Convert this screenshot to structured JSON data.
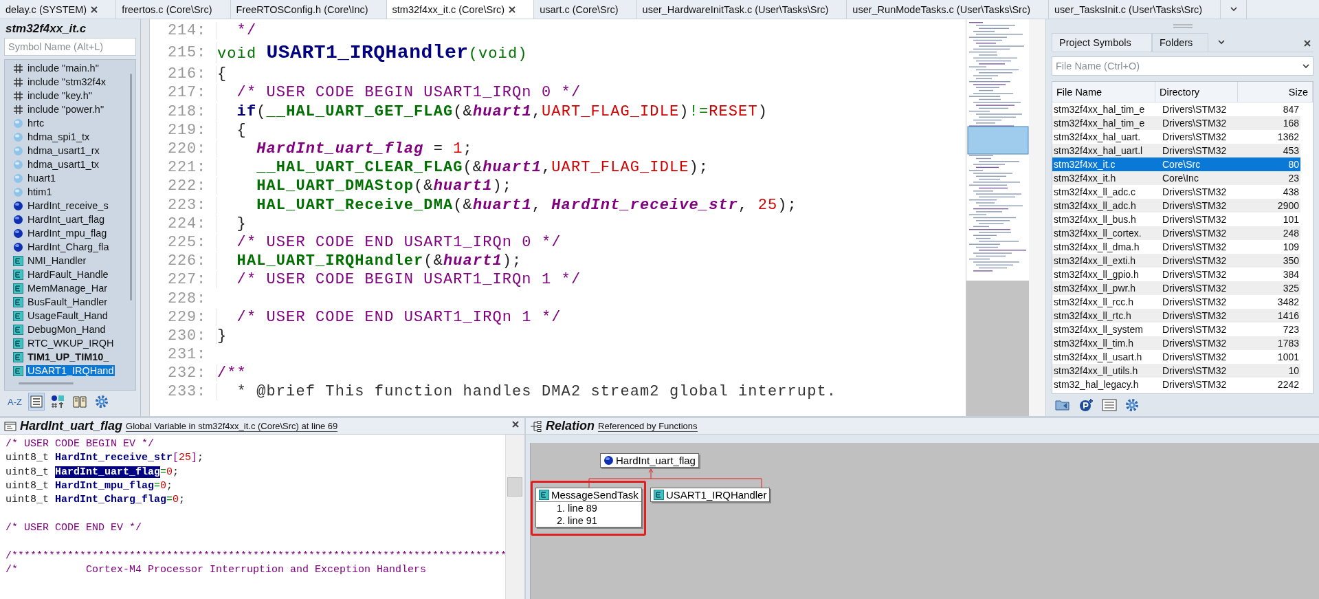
{
  "tabs": [
    {
      "label": "delay.c (SYSTEM)",
      "selected": false,
      "closable": true
    },
    {
      "label": "freertos.c (Core\\Src)",
      "selected": false,
      "closable": false
    },
    {
      "label": "FreeRTOSConfig.h (Core\\Inc)",
      "selected": false,
      "closable": false
    },
    {
      "label": "stm32f4xx_it.c (Core\\Src)",
      "selected": true,
      "closable": true
    },
    {
      "label": "usart.c (Core\\Src)",
      "selected": false,
      "closable": false
    },
    {
      "label": "user_HardwareInitTask.c (User\\Tasks\\Src)",
      "selected": false,
      "closable": false
    },
    {
      "label": "user_RunModeTasks.c (User\\Tasks\\Src)",
      "selected": false,
      "closable": false
    },
    {
      "label": "user_TasksInit.c (User\\Tasks\\Src)",
      "selected": false,
      "closable": false
    }
  ],
  "symbol_window": {
    "title": "stm32f4xx_it.c",
    "search_placeholder": "Symbol Name (Alt+L)",
    "sort_label": "A-Z",
    "items": [
      {
        "kind": "include",
        "label": "include \"main.h\"",
        "selected": false,
        "emphasized": false
      },
      {
        "kind": "include",
        "label": "include \"stm32f4x",
        "selected": false,
        "emphasized": false
      },
      {
        "kind": "include",
        "label": "include \"key.h\"",
        "selected": false,
        "emphasized": false
      },
      {
        "kind": "include",
        "label": "include \"power.h\"",
        "selected": false,
        "emphasized": false
      },
      {
        "kind": "extern",
        "label": "hrtc",
        "selected": false,
        "emphasized": false
      },
      {
        "kind": "extern",
        "label": "hdma_spi1_tx",
        "selected": false,
        "emphasized": false
      },
      {
        "kind": "extern",
        "label": "hdma_usart1_rx",
        "selected": false,
        "emphasized": false
      },
      {
        "kind": "extern",
        "label": "hdma_usart1_tx",
        "selected": false,
        "emphasized": false
      },
      {
        "kind": "extern",
        "label": "huart1",
        "selected": false,
        "emphasized": false
      },
      {
        "kind": "extern",
        "label": "htim1",
        "selected": false,
        "emphasized": false
      },
      {
        "kind": "variable",
        "label": "HardInt_receive_s",
        "selected": false,
        "emphasized": false
      },
      {
        "kind": "variable",
        "label": "HardInt_uart_flag",
        "selected": false,
        "emphasized": false
      },
      {
        "kind": "variable",
        "label": "HardInt_mpu_flag",
        "selected": false,
        "emphasized": false
      },
      {
        "kind": "variable",
        "label": "HardInt_Charg_fla",
        "selected": false,
        "emphasized": false
      },
      {
        "kind": "function",
        "label": "NMI_Handler",
        "selected": false,
        "emphasized": false
      },
      {
        "kind": "function",
        "label": "HardFault_Handle",
        "selected": false,
        "emphasized": false
      },
      {
        "kind": "function",
        "label": "MemManage_Har",
        "selected": false,
        "emphasized": false
      },
      {
        "kind": "function",
        "label": "BusFault_Handler",
        "selected": false,
        "emphasized": false
      },
      {
        "kind": "function",
        "label": "UsageFault_Hand",
        "selected": false,
        "emphasized": false
      },
      {
        "kind": "function",
        "label": "DebugMon_Hand",
        "selected": false,
        "emphasized": false
      },
      {
        "kind": "function",
        "label": "RTC_WKUP_IRQH",
        "selected": false,
        "emphasized": false
      },
      {
        "kind": "function",
        "label": "TIM1_UP_TIM10_",
        "selected": false,
        "emphasized": true
      },
      {
        "kind": "function",
        "label": "USART1_IRQHand",
        "selected": true,
        "emphasized": false
      }
    ]
  },
  "editor": {
    "lines": [
      {
        "number": "214:",
        "tokens": [
          {
            "kind": "comment",
            "text": "  */"
          }
        ]
      },
      {
        "number": "215:",
        "tokens": [
          {
            "kind": "type",
            "text": "void "
          },
          {
            "kind": "title",
            "text": "USART1_IRQHandler"
          },
          {
            "kind": "type",
            "text": "(void)"
          }
        ]
      },
      {
        "number": "216:",
        "tokens": [
          {
            "kind": "plain",
            "text": "{"
          }
        ]
      },
      {
        "number": "217:",
        "tokens": [
          {
            "kind": "comment",
            "text": "  /* USER CODE BEGIN USART1_IRQn 0 */"
          }
        ]
      },
      {
        "number": "218:",
        "tokens": [
          {
            "kind": "keyword",
            "text": "  if"
          },
          {
            "kind": "plain",
            "text": "("
          },
          {
            "kind": "func",
            "text": "__HAL_UART_GET_FLAG"
          },
          {
            "kind": "plain",
            "text": "(&"
          },
          {
            "kind": "var",
            "text": "huart1"
          },
          {
            "kind": "plain",
            "text": ","
          },
          {
            "kind": "const",
            "text": "UART_FLAG_IDLE"
          },
          {
            "kind": "plain",
            "text": ")"
          },
          {
            "kind": "op",
            "text": "!="
          },
          {
            "kind": "const",
            "text": "RESET"
          },
          {
            "kind": "plain",
            "text": ")"
          }
        ]
      },
      {
        "number": "219:",
        "tokens": [
          {
            "kind": "plain",
            "text": "  {"
          }
        ]
      },
      {
        "number": "220:",
        "tokens": [
          {
            "kind": "var",
            "text": "    HardInt_uart_flag"
          },
          {
            "kind": "plain",
            "text": " = "
          },
          {
            "kind": "num",
            "text": "1"
          },
          {
            "kind": "plain",
            "text": ";"
          }
        ]
      },
      {
        "number": "221:",
        "tokens": [
          {
            "kind": "func",
            "text": "    __HAL_UART_CLEAR_FLAG"
          },
          {
            "kind": "plain",
            "text": "(&"
          },
          {
            "kind": "var",
            "text": "huart1"
          },
          {
            "kind": "plain",
            "text": ","
          },
          {
            "kind": "const",
            "text": "UART_FLAG_IDLE"
          },
          {
            "kind": "plain",
            "text": ");"
          }
        ]
      },
      {
        "number": "222:",
        "tokens": [
          {
            "kind": "func",
            "text": "    HAL_UART_DMAStop"
          },
          {
            "kind": "plain",
            "text": "(&"
          },
          {
            "kind": "var",
            "text": "huart1"
          },
          {
            "kind": "plain",
            "text": ");"
          }
        ]
      },
      {
        "number": "223:",
        "tokens": [
          {
            "kind": "func",
            "text": "    HAL_UART_Receive_DMA"
          },
          {
            "kind": "plain",
            "text": "(&"
          },
          {
            "kind": "var",
            "text": "huart1"
          },
          {
            "kind": "plain",
            "text": ", "
          },
          {
            "kind": "var",
            "text": "HardInt_receive_str"
          },
          {
            "kind": "plain",
            "text": ", "
          },
          {
            "kind": "num",
            "text": "25"
          },
          {
            "kind": "plain",
            "text": ");"
          }
        ]
      },
      {
        "number": "224:",
        "tokens": [
          {
            "kind": "plain",
            "text": "  }"
          }
        ]
      },
      {
        "number": "225:",
        "tokens": [
          {
            "kind": "comment",
            "text": "  /* USER CODE END USART1_IRQn 0 */"
          }
        ]
      },
      {
        "number": "226:",
        "tokens": [
          {
            "kind": "func",
            "text": "  HAL_UART_IRQHandler"
          },
          {
            "kind": "plain",
            "text": "(&"
          },
          {
            "kind": "var",
            "text": "huart1"
          },
          {
            "kind": "plain",
            "text": ");"
          }
        ]
      },
      {
        "number": "227:",
        "tokens": [
          {
            "kind": "comment",
            "text": "  /* USER CODE BEGIN USART1_IRQn 1 */"
          }
        ]
      },
      {
        "number": "228:"
      },
      {
        "number": "229:",
        "tokens": [
          {
            "kind": "comment",
            "text": "  /* USER CODE END USART1_IRQn 1 */"
          }
        ]
      },
      {
        "number": "230:",
        "tokens": [
          {
            "kind": "plain",
            "text": "}"
          }
        ]
      },
      {
        "number": "231:"
      },
      {
        "number": "232:",
        "tokens": [
          {
            "kind": "comment",
            "text": "/**"
          }
        ]
      },
      {
        "number": "233:",
        "tokens": [
          {
            "kind": "doc",
            "text": "  * @brief This function handles DMA2 stream2 global interrupt."
          }
        ]
      }
    ]
  },
  "project_window": {
    "tabs": [
      {
        "label": "Project Symbols",
        "selected": true
      },
      {
        "label": "Folders",
        "selected": false
      }
    ],
    "search_placeholder": "File Name (Ctrl+O)",
    "columns": [
      "File Name",
      "Directory",
      "Size"
    ],
    "rows": [
      {
        "name": "stm32f4xx_hal_tim_e",
        "directory": "Drivers\\STM32",
        "size": "847",
        "selected": false
      },
      {
        "name": "stm32f4xx_hal_tim_e",
        "directory": "Drivers\\STM32",
        "size": "168",
        "selected": false
      },
      {
        "name": "stm32f4xx_hal_uart.",
        "directory": "Drivers\\STM32",
        "size": "1362",
        "selected": false
      },
      {
        "name": "stm32f4xx_hal_uart.l",
        "directory": "Drivers\\STM32",
        "size": "453",
        "selected": false
      },
      {
        "name": "stm32f4xx_it.c",
        "directory": "Core\\Src",
        "size": "80",
        "selected": true
      },
      {
        "name": "stm32f4xx_it.h",
        "directory": "Core\\Inc",
        "size": "23",
        "selected": false
      },
      {
        "name": "stm32f4xx_ll_adc.c",
        "directory": "Drivers\\STM32",
        "size": "438",
        "selected": false
      },
      {
        "name": "stm32f4xx_ll_adc.h",
        "directory": "Drivers\\STM32",
        "size": "2900",
        "selected": false
      },
      {
        "name": "stm32f4xx_ll_bus.h",
        "directory": "Drivers\\STM32",
        "size": "101",
        "selected": false
      },
      {
        "name": "stm32f4xx_ll_cortex.",
        "directory": "Drivers\\STM32",
        "size": "248",
        "selected": false
      },
      {
        "name": "stm32f4xx_ll_dma.h",
        "directory": "Drivers\\STM32",
        "size": "109",
        "selected": false
      },
      {
        "name": "stm32f4xx_ll_exti.h",
        "directory": "Drivers\\STM32",
        "size": "350",
        "selected": false
      },
      {
        "name": "stm32f4xx_ll_gpio.h",
        "directory": "Drivers\\STM32",
        "size": "384",
        "selected": false
      },
      {
        "name": "stm32f4xx_ll_pwr.h",
        "directory": "Drivers\\STM32",
        "size": "325",
        "selected": false
      },
      {
        "name": "stm32f4xx_ll_rcc.h",
        "directory": "Drivers\\STM32",
        "size": "3482",
        "selected": false
      },
      {
        "name": "stm32f4xx_ll_rtc.h",
        "directory": "Drivers\\STM32",
        "size": "1416",
        "selected": false
      },
      {
        "name": "stm32f4xx_ll_system",
        "directory": "Drivers\\STM32",
        "size": "723",
        "selected": false
      },
      {
        "name": "stm32f4xx_ll_tim.h",
        "directory": "Drivers\\STM32",
        "size": "1783",
        "selected": false
      },
      {
        "name": "stm32f4xx_ll_usart.h",
        "directory": "Drivers\\STM32",
        "size": "1001",
        "selected": false
      },
      {
        "name": "stm32f4xx_ll_utils.h",
        "directory": "Drivers\\STM32",
        "size": "10",
        "selected": false
      },
      {
        "name": "stm32_hal_legacy.h",
        "directory": "Drivers\\STM32",
        "size": "2242",
        "selected": false
      }
    ]
  },
  "context_window": {
    "symbol": "HardInt_uart_flag",
    "description": "Global Variable in stm32f4xx_it.c (Core\\Src) at line 69",
    "lines": [
      {
        "tokens": [
          {
            "kind": "comment",
            "text": "/* USER CODE BEGIN EV */"
          }
        ]
      },
      {
        "tokens": [
          {
            "kind": "plain",
            "text": "uint8_t "
          },
          {
            "kind": "decl",
            "text": "HardInt_receive_str"
          },
          {
            "kind": "punct",
            "text": "["
          },
          {
            "kind": "num",
            "text": "25"
          },
          {
            "kind": "punct",
            "text": "]"
          },
          {
            "kind": "plain",
            "text": ";"
          }
        ]
      },
      {
        "tokens": [
          {
            "kind": "plain",
            "text": "uint8_t "
          },
          {
            "kind": "selection",
            "text": "HardInt_uart_flag"
          },
          {
            "kind": "op",
            "text": "="
          },
          {
            "kind": "num",
            "text": "0"
          },
          {
            "kind": "plain",
            "text": ";"
          }
        ]
      },
      {
        "tokens": [
          {
            "kind": "plain",
            "text": "uint8_t "
          },
          {
            "kind": "decl",
            "text": "HardInt_mpu_flag"
          },
          {
            "kind": "op",
            "text": "="
          },
          {
            "kind": "num",
            "text": "0"
          },
          {
            "kind": "plain",
            "text": ";"
          }
        ]
      },
      {
        "tokens": [
          {
            "kind": "plain",
            "text": "uint8_t "
          },
          {
            "kind": "decl",
            "text": "HardInt_Charg_flag"
          },
          {
            "kind": "op",
            "text": "="
          },
          {
            "kind": "num",
            "text": "0"
          },
          {
            "kind": "plain",
            "text": ";"
          }
        ]
      },
      {
        "space_before": true,
        "tokens": [
          {
            "kind": "comment",
            "text": "/* USER CODE END EV */"
          }
        ]
      },
      {
        "space_before": true,
        "tokens": [
          {
            "kind": "comment",
            "text": "/********************************************************************************"
          }
        ]
      },
      {
        "tokens": [
          {
            "kind": "comment",
            "text": "/*           Cortex-M4 Processor Interruption and Exception Handlers"
          }
        ]
      }
    ]
  },
  "relation_window": {
    "title": "Relation",
    "subtitle": "Referenced by Functions",
    "root": {
      "label": "HardInt_uart_flag"
    },
    "children": [
      {
        "label": "MessageSendTask",
        "highlighted": true,
        "references": [
          "1. line 89",
          "2. line 91"
        ]
      },
      {
        "label": "USART1_IRQHandler",
        "highlighted": false
      }
    ]
  }
}
